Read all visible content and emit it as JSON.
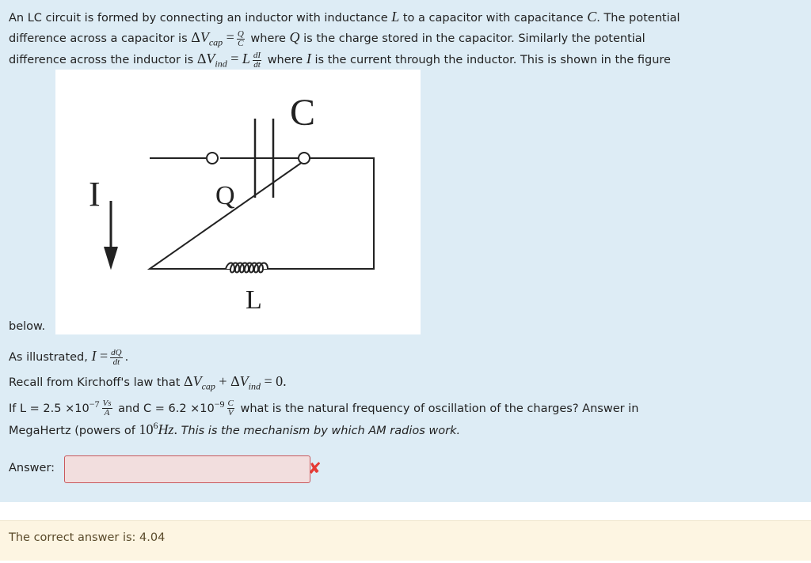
{
  "question": {
    "l1": "An LC circuit is formed by connecting an inductor with inductance",
    "l1b": "to a capacitor with capacitance",
    "l1c": ". The potential",
    "l2a": "difference across a capacitor is",
    "l2b": "where",
    "l2c": "is the charge stored in the capacitor. Similarly the potential",
    "l3a": "difference across the inductor is",
    "l3b": "where",
    "l3c": "is the current through the inductor. This is shown in the figure",
    "below": "below.",
    "illus": "As illustrated,",
    "recall": "Recall from Kirchoff's law that",
    "if1": "If L = 2.5 ×10",
    "exp1": "−7",
    "and": "and C = 6.2 ×10",
    "exp2": "−9",
    "what": "what is the natural frequency of oscillation of the charges? Answer in",
    "mega": "MegaHertz (powers of",
    "italic": "This is the mechanism by which AM radios work."
  },
  "figure": {
    "c_label": "C",
    "q_label": "Q",
    "i_label": "I",
    "l_label": "L"
  },
  "answer": {
    "label": "Answer:",
    "value": "",
    "status": "incorrect",
    "status_color": "#e53b35"
  },
  "feedback": {
    "text": "The correct answer is: 4.04"
  }
}
